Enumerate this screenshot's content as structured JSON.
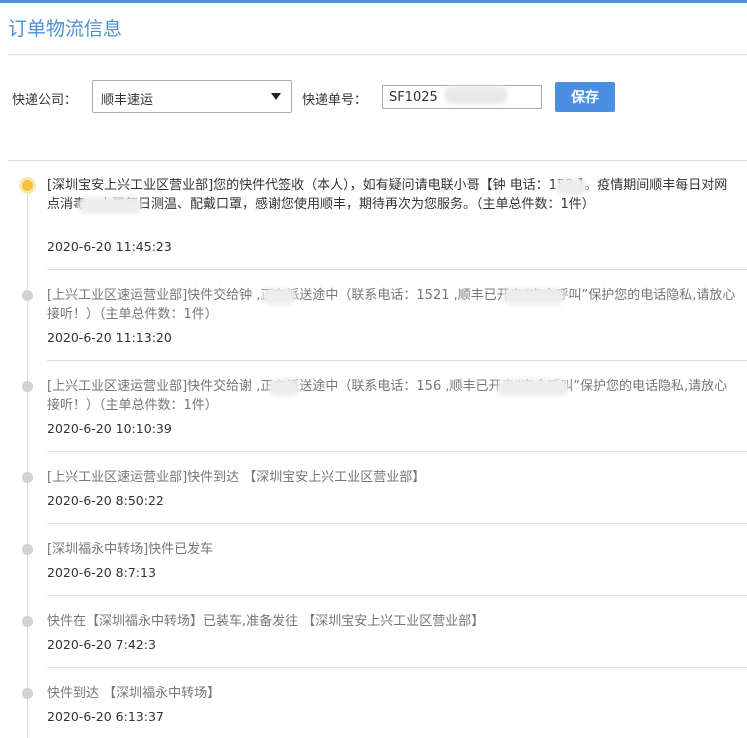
{
  "page": {
    "title": "订单物流信息",
    "accent": "#4a90e2"
  },
  "form": {
    "company_label": "快递公司：",
    "company_value": "顺丰速运",
    "tracking_label": "快递单号：",
    "tracking_value": "SF1025",
    "save_label": "保存"
  },
  "events": [
    {
      "text": "[深圳宝安上兴工业区营业部]您的快件代签收（本人），如有疑问请电联小哥【钟      电话：152          】。疫情期间顺丰每日对网点消毒、小哥每日测温、配戴口罩，感谢您使用顺丰，期待再次为您服务。（主单总件数：1件）",
      "time": "2020-6-20 11:45:23",
      "status": "latest"
    },
    {
      "text": "[上兴工业区速运营业部]快件交给钟     ,正在派送途中（联系电话：1521          ,顺丰已开启“安全呼叫”保护您的电话隐私,请放心接听！）（主单总件数：1件）",
      "time": "2020-6-20 11:13:20",
      "status": "past"
    },
    {
      "text": "[上兴工业区速运营业部]快件交给谢     ,正在派送途中（联系电话：156          ,顺丰已开启“安全呼叫”保护您的电话隐私,请放心接听！）（主单总件数：1件）",
      "time": "2020-6-20 10:10:39",
      "status": "past"
    },
    {
      "text": "[上兴工业区速运营业部]快件到达 【深圳宝安上兴工业区营业部】",
      "time": "2020-6-20 8:50:22",
      "status": "past"
    },
    {
      "text": "[深圳福永中转场]快件已发车",
      "time": "2020-6-20 8:7:13",
      "status": "past"
    },
    {
      "text": "快件在【深圳福永中转场】已装车,准备发往 【深圳宝安上兴工业区营业部】",
      "time": "2020-6-20 7:42:3",
      "status": "past"
    },
    {
      "text": "快件到达 【深圳福永中转场】",
      "time": "2020-6-20 6:13:37",
      "status": "past"
    }
  ]
}
